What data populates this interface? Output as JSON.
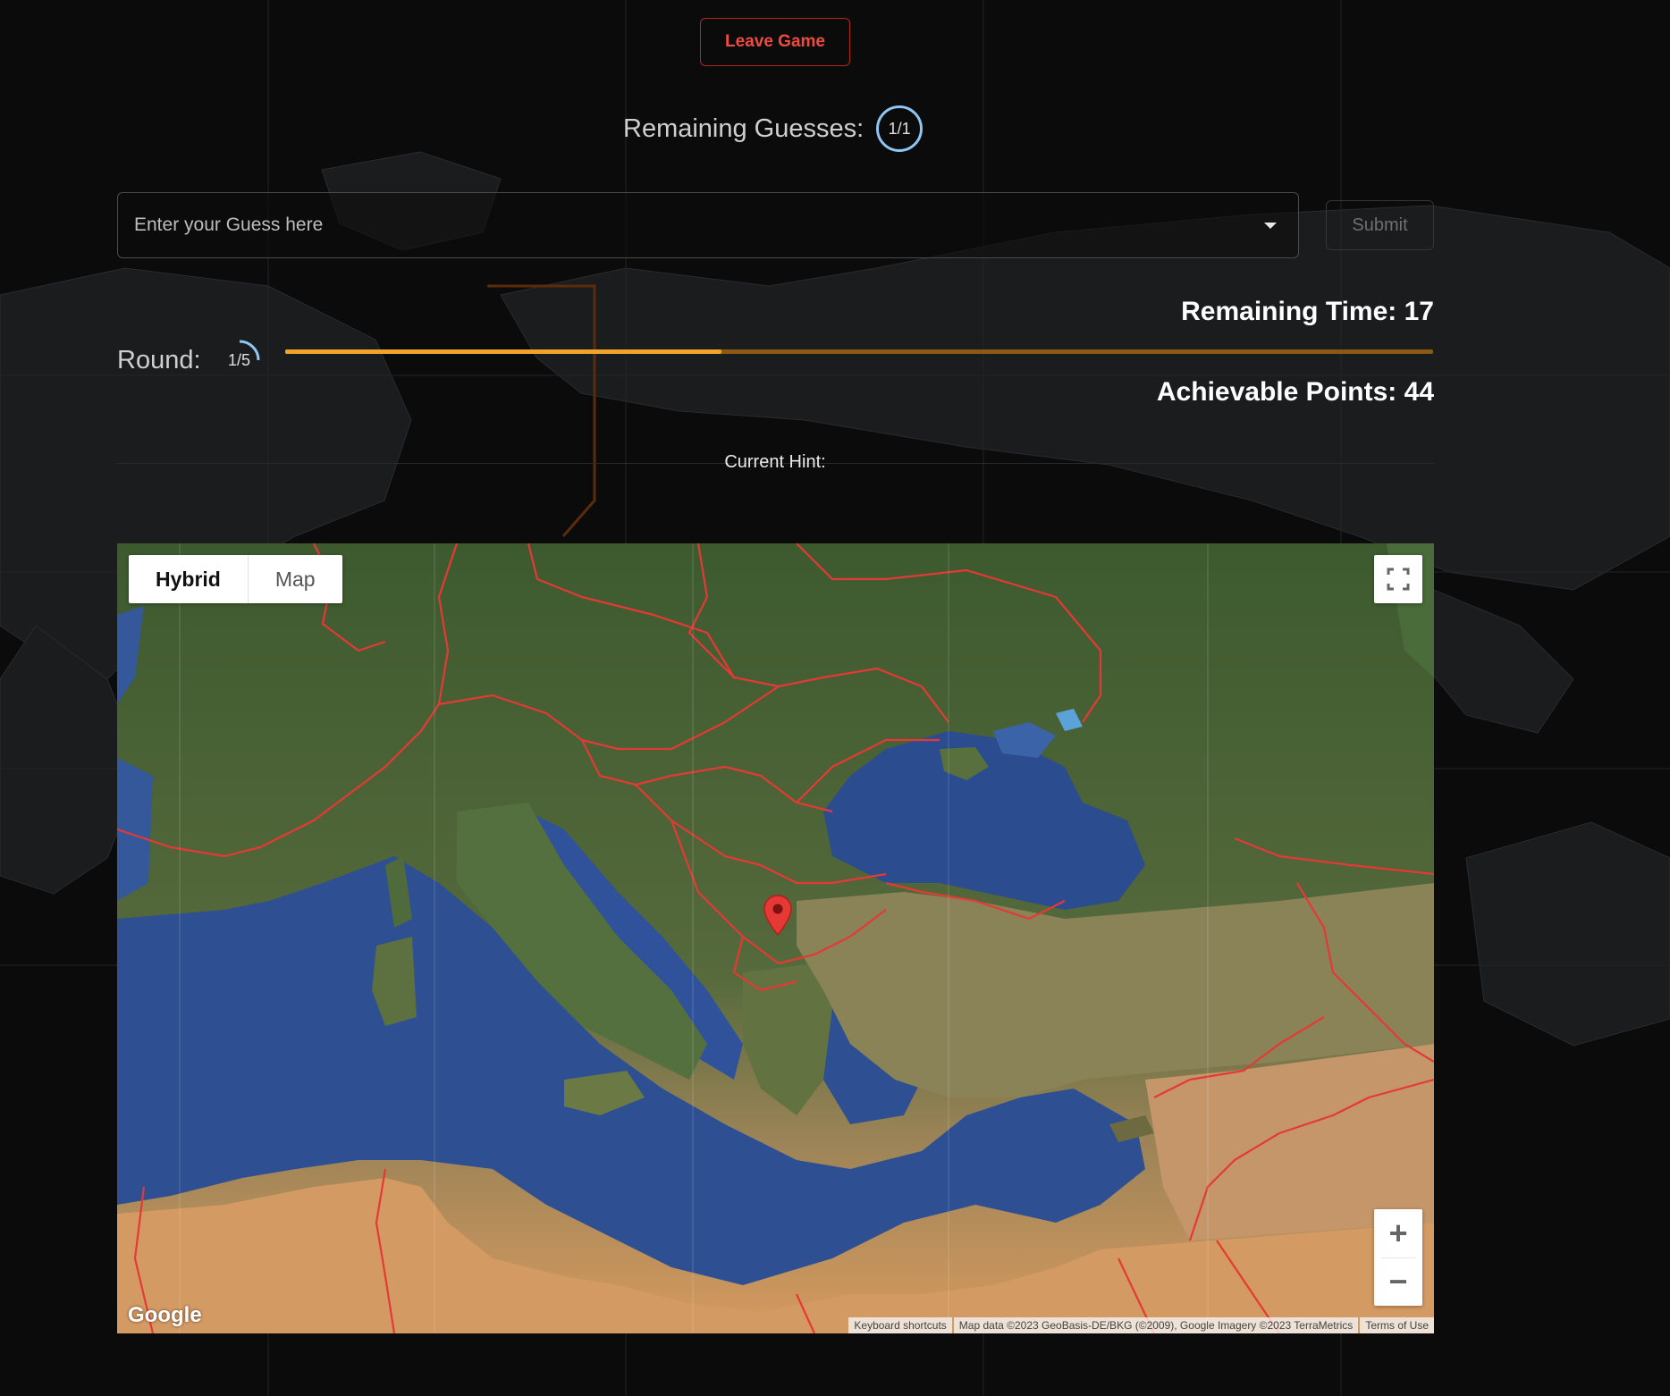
{
  "header": {
    "leave_button": "Leave Game"
  },
  "guesses": {
    "label": "Remaining Guesses:",
    "value": "1/1"
  },
  "guess_input": {
    "placeholder": "Enter your Guess here",
    "submit_label": "Submit"
  },
  "timer": {
    "text": "Remaining Time: 17"
  },
  "round": {
    "label": "Round:",
    "value": "1/5"
  },
  "progress": {
    "fraction": 0.38
  },
  "points": {
    "text": "Achievable Points: 44"
  },
  "hint": {
    "label": "Current Hint:"
  },
  "map": {
    "type_options": [
      "Hybrid",
      "Map"
    ],
    "selected_type": "Hybrid",
    "logo": "Google",
    "attribution": [
      "Keyboard shortcuts",
      "Map data ©2023 GeoBasis-DE/BKG (©2009), Google Imagery ©2023 TerraMetrics",
      "Terms of Use"
    ],
    "controls": {
      "fullscreen": "fullscreen-icon",
      "zoom_in": "+",
      "zoom_out": "−"
    }
  },
  "colors": {
    "accent_red": "#f04b3f",
    "progress_fill": "#f0a22a",
    "progress_track": "#8a5a13",
    "badge_ring": "#8ec5f1",
    "border_red": "#e53935",
    "marker": "#e53935"
  }
}
